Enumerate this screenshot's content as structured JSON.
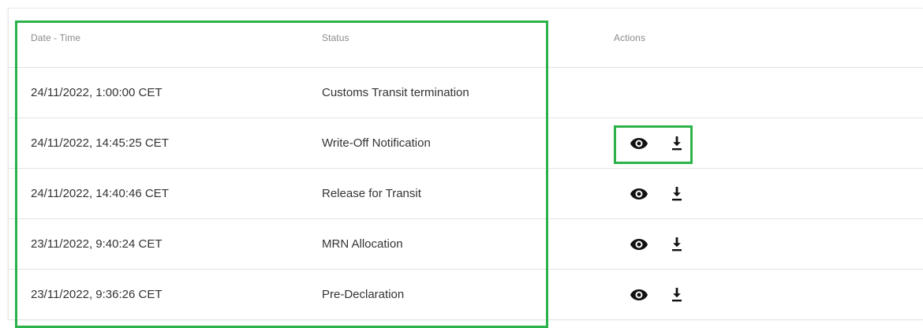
{
  "table": {
    "columns": {
      "date": "Date - Time",
      "status": "Status",
      "actions": "Actions"
    },
    "rows": [
      {
        "date": "24/11/2022, 1:00:00 CET",
        "status": "Customs Transit termination",
        "actions": []
      },
      {
        "date": "24/11/2022, 14:45:25 CET",
        "status": "Write-Off Notification",
        "actions": [
          "eye-icon",
          "download-icon"
        ]
      },
      {
        "date": "24/11/2022, 14:40:46 CET",
        "status": "Release for Transit",
        "actions": [
          "eye-icon",
          "download-icon"
        ]
      },
      {
        "date": "23/11/2022, 9:40:24 CET",
        "status": "MRN Allocation",
        "actions": [
          "eye-icon",
          "download-icon"
        ]
      },
      {
        "date": "23/11/2022, 9:36:26 CET",
        "status": "Pre-Declaration",
        "actions": [
          "eye-icon",
          "download-icon"
        ]
      }
    ]
  },
  "colors": {
    "highlight": "#2bb34a",
    "text": "#333333",
    "header_text": "#8a8a8a",
    "divider": "#e3e3e3",
    "icon": "#111111"
  }
}
